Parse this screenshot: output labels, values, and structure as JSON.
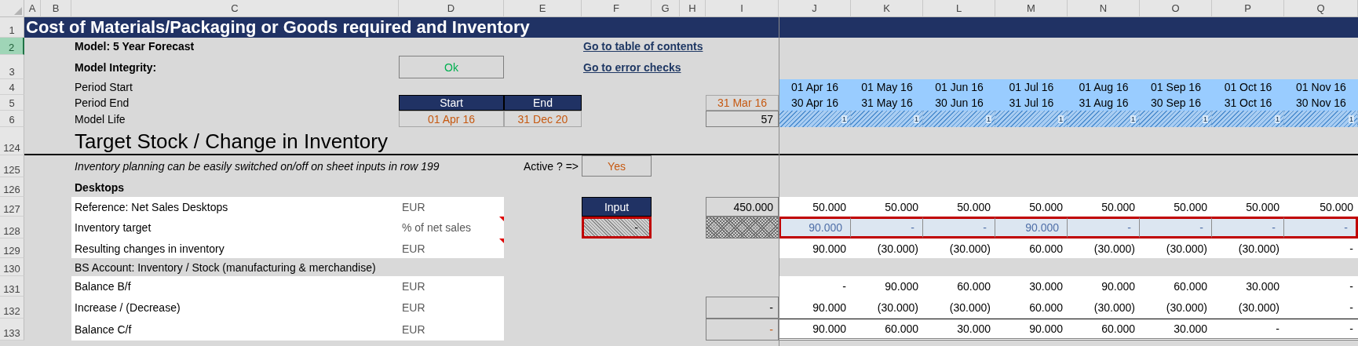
{
  "column_headers": [
    "A",
    "B",
    "C",
    "D",
    "E",
    "F",
    "G",
    "H",
    "I",
    "J",
    "K",
    "L",
    "M",
    "N",
    "O",
    "P",
    "Q"
  ],
  "rows": [
    {
      "number": "1",
      "selected": false,
      "kind": "banner",
      "cells": {
        "A": {
          "kind": "title",
          "text": "Cost of Materials/Packaging or Goods required and Inventory"
        }
      }
    },
    {
      "number": "2",
      "selected": true,
      "cells": {
        "C": {
          "kind": "heading",
          "text": "Model: 5 Year Forecast"
        },
        "F": {
          "kind": "link",
          "text": "Go to table of contents"
        }
      }
    },
    {
      "number": "3",
      "selected": false,
      "cells": {
        "C": {
          "kind": "heading",
          "text": "Model Integrity:"
        },
        "D": {
          "kind": "status_ok",
          "text": "Ok"
        },
        "F": {
          "kind": "link",
          "text": "Go to error checks"
        }
      }
    },
    {
      "number": "4",
      "selected": false,
      "cells": {
        "C": {
          "kind": "text",
          "text": "Period Start"
        },
        "J": {
          "kind": "period",
          "text": "01 Apr 16"
        },
        "K": {
          "kind": "period",
          "text": "01 May 16"
        },
        "L": {
          "kind": "period",
          "text": "01 Jun 16"
        },
        "M": {
          "kind": "period",
          "text": "01 Jul 16"
        },
        "N": {
          "kind": "period",
          "text": "01 Aug 16"
        },
        "O": {
          "kind": "period",
          "text": "01 Sep 16"
        },
        "P": {
          "kind": "period",
          "text": "01 Oct 16"
        },
        "Q": {
          "kind": "period",
          "text": "01 Nov 16"
        }
      }
    },
    {
      "number": "5",
      "selected": false,
      "cells": {
        "C": {
          "kind": "text",
          "text": "Period End"
        },
        "D": {
          "kind": "header_dark",
          "text": "Start"
        },
        "E": {
          "kind": "header_dark",
          "text": "End"
        },
        "I": {
          "kind": "date_input",
          "text": "31 Mar 16"
        },
        "J": {
          "kind": "period",
          "text": "30 Apr 16"
        },
        "K": {
          "kind": "period",
          "text": "31 May 16"
        },
        "L": {
          "kind": "period",
          "text": "30 Jun 16"
        },
        "M": {
          "kind": "period",
          "text": "31 Jul 16"
        },
        "N": {
          "kind": "period",
          "text": "31 Aug 16"
        },
        "O": {
          "kind": "period",
          "text": "30 Sep 16"
        },
        "P": {
          "kind": "period",
          "text": "31 Oct 16"
        },
        "Q": {
          "kind": "period",
          "text": "30 Nov 16"
        }
      }
    },
    {
      "number": "6",
      "selected": false,
      "cells": {
        "C": {
          "kind": "text",
          "text": "Model Life"
        },
        "D": {
          "kind": "date_input",
          "text": "01 Apr 16"
        },
        "E": {
          "kind": "date_input",
          "text": "31 Dec 20"
        },
        "I": {
          "kind": "boxed_number",
          "text": "57"
        },
        "J": {
          "kind": "hatch_blue",
          "text": "1"
        },
        "K": {
          "kind": "hatch_blue",
          "text": "1"
        },
        "L": {
          "kind": "hatch_blue",
          "text": "1"
        },
        "M": {
          "kind": "hatch_blue",
          "text": "1"
        },
        "N": {
          "kind": "hatch_blue",
          "text": "1"
        },
        "O": {
          "kind": "hatch_blue",
          "text": "1"
        },
        "P": {
          "kind": "hatch_blue",
          "text": "1"
        },
        "Q": {
          "kind": "hatch_blue",
          "text": "1"
        }
      }
    },
    {
      "number": "124",
      "selected": false,
      "kind": "section",
      "cells": {
        "C": {
          "kind": "large",
          "text": "Target Stock / Change in Inventory"
        }
      }
    },
    {
      "number": "125",
      "selected": false,
      "cells": {
        "C": {
          "kind": "italic",
          "text": "Inventory planning can be easily switched on/off on sheet inputs in row 199"
        },
        "E": {
          "kind": "label_right",
          "text": "Active ? =>"
        },
        "F": {
          "kind": "toggle",
          "text": "Yes"
        }
      }
    },
    {
      "number": "126",
      "selected": false,
      "cells": {
        "C": {
          "kind": "heading",
          "text": "Desktops"
        }
      }
    },
    {
      "number": "127",
      "selected": false,
      "cells": {
        "C": {
          "kind": "row_label",
          "text": "Reference: Net Sales Desktops"
        },
        "D": {
          "kind": "unit",
          "text": "EUR"
        },
        "F": {
          "kind": "header_dark",
          "text": "Input"
        },
        "I": {
          "kind": "boxed_number",
          "text": "450.000"
        },
        "J": {
          "kind": "value",
          "text": "50.000"
        },
        "K": {
          "kind": "value",
          "text": "50.000"
        },
        "L": {
          "kind": "value",
          "text": "50.000"
        },
        "M": {
          "kind": "value",
          "text": "50.000"
        },
        "N": {
          "kind": "value",
          "text": "50.000"
        },
        "O": {
          "kind": "value",
          "text": "50.000"
        },
        "P": {
          "kind": "value",
          "text": "50.000"
        },
        "Q": {
          "kind": "value",
          "text": "50.000"
        }
      }
    },
    {
      "number": "128",
      "selected": false,
      "cells": {
        "C": {
          "kind": "row_label",
          "text": "Inventory target"
        },
        "D": {
          "kind": "unit",
          "comment": true,
          "text": "% of net sales"
        },
        "F": {
          "kind": "hatch_grey",
          "outlined": true,
          "text": "-"
        },
        "I": {
          "kind": "hatch_dots"
        },
        "J": {
          "kind": "input_value",
          "outlined": true,
          "text": "90.000"
        },
        "K": {
          "kind": "input_value",
          "outlined": true,
          "text": "-"
        },
        "L": {
          "kind": "input_value",
          "outlined": true,
          "text": "-"
        },
        "M": {
          "kind": "input_value",
          "outlined": true,
          "text": "90.000"
        },
        "N": {
          "kind": "input_value",
          "outlined": true,
          "text": "-"
        },
        "O": {
          "kind": "input_value",
          "outlined": true,
          "text": "-"
        },
        "P": {
          "kind": "input_value",
          "outlined": true,
          "text": "-"
        },
        "Q": {
          "kind": "input_value",
          "outlined": true,
          "text": "-"
        }
      }
    },
    {
      "number": "129",
      "selected": false,
      "cells": {
        "C": {
          "kind": "row_label",
          "text": "Resulting changes in inventory"
        },
        "D": {
          "kind": "unit",
          "comment": true,
          "text": "EUR"
        },
        "J": {
          "kind": "value",
          "text": "90.000"
        },
        "K": {
          "kind": "value",
          "text": "(30.000)"
        },
        "L": {
          "kind": "value",
          "text": "(30.000)"
        },
        "M": {
          "kind": "value",
          "text": "60.000"
        },
        "N": {
          "kind": "value",
          "text": "(30.000)"
        },
        "O": {
          "kind": "value",
          "text": "(30.000)"
        },
        "P": {
          "kind": "value",
          "text": "(30.000)"
        },
        "Q": {
          "kind": "value",
          "text": "-"
        }
      }
    },
    {
      "number": "130",
      "selected": false,
      "cells": {
        "C": {
          "kind": "text",
          "text": "BS Account: Inventory / Stock (manufacturing & merchandise)"
        }
      }
    },
    {
      "number": "131",
      "selected": false,
      "cells": {
        "C": {
          "kind": "row_label",
          "text": "Balance B/f"
        },
        "D": {
          "kind": "unit",
          "text": "EUR"
        },
        "J": {
          "kind": "value",
          "text": "-"
        },
        "K": {
          "kind": "value",
          "text": "90.000"
        },
        "L": {
          "kind": "value",
          "text": "60.000"
        },
        "M": {
          "kind": "value",
          "text": "30.000"
        },
        "N": {
          "kind": "value",
          "text": "90.000"
        },
        "O": {
          "kind": "value",
          "text": "60.000"
        },
        "P": {
          "kind": "value",
          "text": "30.000"
        },
        "Q": {
          "kind": "value",
          "text": "-"
        }
      }
    },
    {
      "number": "132",
      "selected": false,
      "cells": {
        "C": {
          "kind": "row_label",
          "text": "Increase / (Decrease)"
        },
        "D": {
          "kind": "unit",
          "text": "EUR"
        },
        "I": {
          "kind": "boxed_number",
          "text": "-"
        },
        "J": {
          "kind": "value",
          "text": "90.000"
        },
        "K": {
          "kind": "value",
          "text": "(30.000)"
        },
        "L": {
          "kind": "value",
          "text": "(30.000)"
        },
        "M": {
          "kind": "value",
          "text": "60.000"
        },
        "N": {
          "kind": "value",
          "text": "(30.000)"
        },
        "O": {
          "kind": "value",
          "text": "(30.000)"
        },
        "P": {
          "kind": "value",
          "text": "(30.000)"
        },
        "Q": {
          "kind": "value",
          "text": "-"
        }
      }
    },
    {
      "number": "133",
      "selected": false,
      "cells": {
        "C": {
          "kind": "row_label",
          "text": "Balance C/f"
        },
        "D": {
          "kind": "unit",
          "text": "EUR"
        },
        "I": {
          "kind": "boxed_orange",
          "text": "-"
        },
        "J": {
          "kind": "total",
          "text": "90.000"
        },
        "K": {
          "kind": "total",
          "text": "60.000"
        },
        "L": {
          "kind": "total",
          "text": "30.000"
        },
        "M": {
          "kind": "total",
          "text": "90.000"
        },
        "N": {
          "kind": "total",
          "text": "60.000"
        },
        "O": {
          "kind": "total",
          "text": "30.000"
        },
        "P": {
          "kind": "total",
          "text": "-"
        },
        "Q": {
          "kind": "total",
          "text": "-"
        }
      }
    }
  ]
}
